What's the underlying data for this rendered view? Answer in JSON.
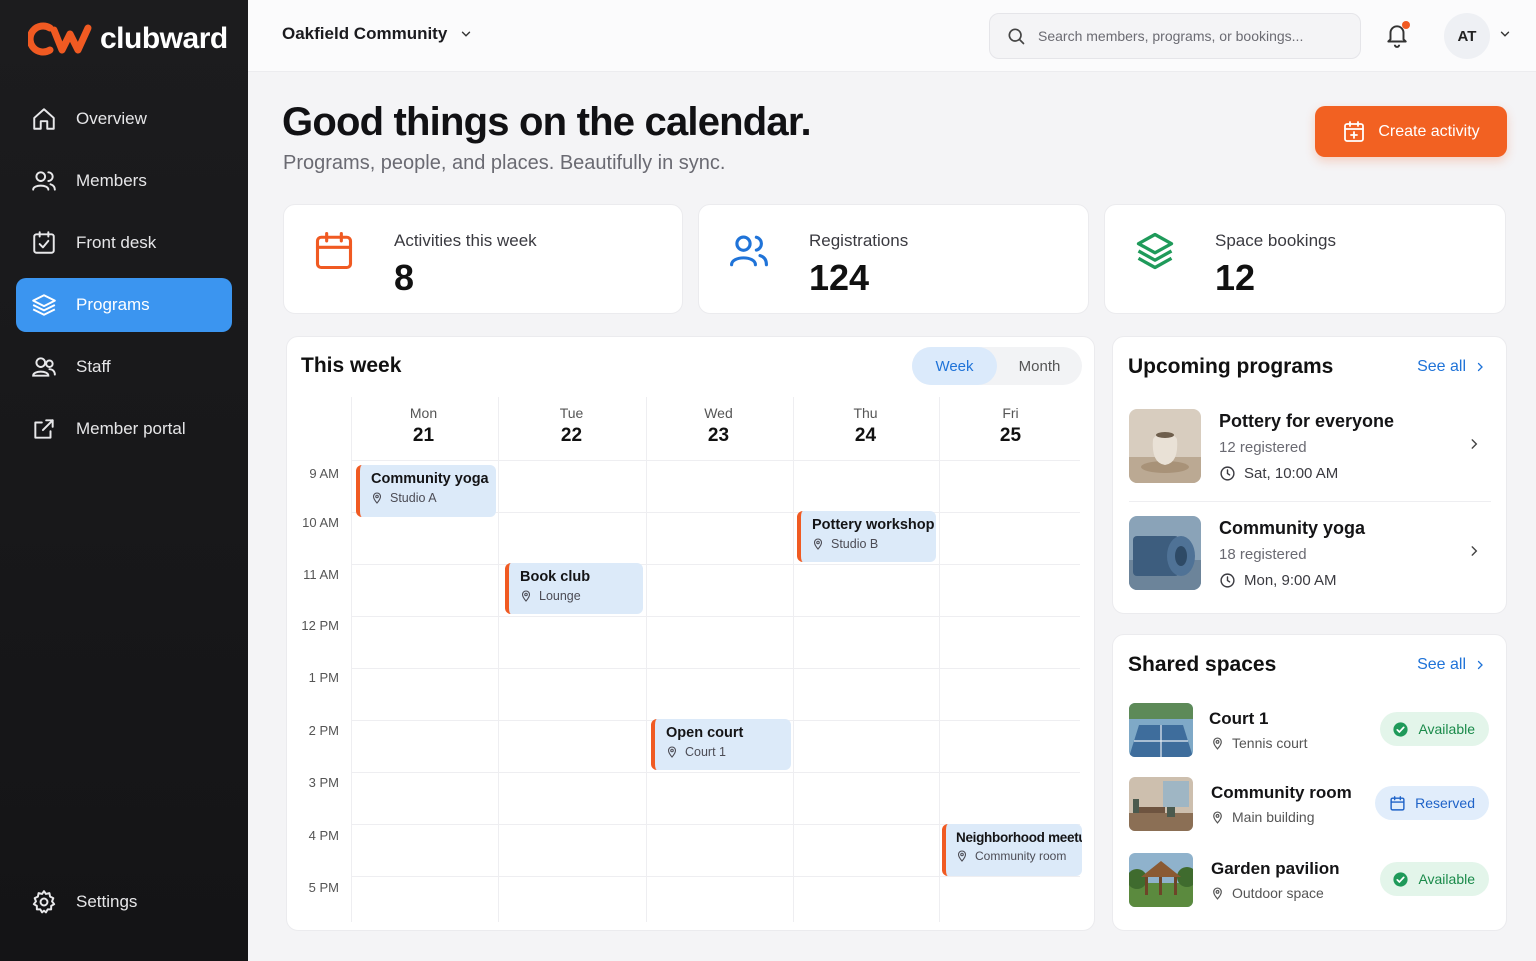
{
  "brand": {
    "name": "clubward",
    "accent": "#f26122",
    "nav_active": "#3b95f0"
  },
  "sidebar": {
    "items": [
      {
        "label": "Overview",
        "icon": "home-icon"
      },
      {
        "label": "Members",
        "icon": "users-icon"
      },
      {
        "label": "Front desk",
        "icon": "calendar-check-icon"
      },
      {
        "label": "Programs",
        "icon": "layers-icon",
        "active": true
      },
      {
        "label": "Staff",
        "icon": "user-group-icon"
      },
      {
        "label": "Member portal",
        "icon": "external-link-icon"
      }
    ],
    "settings_label": "Settings"
  },
  "topbar": {
    "org": "Oakfield Community",
    "search_placeholder": "Search members, programs, or bookings...",
    "avatar": "AT"
  },
  "header": {
    "title": "Good things on the calendar.",
    "subtitle": "Programs, people, and places. Beautifully in sync.",
    "create_label": "Create activity"
  },
  "stats": [
    {
      "label": "Activities this week",
      "value": "8",
      "icon": "calendar-icon"
    },
    {
      "label": "Registrations",
      "value": "124",
      "icon": "users-icon"
    },
    {
      "label": "Space bookings",
      "value": "12",
      "icon": "layers-icon"
    }
  ],
  "calendar": {
    "title": "This week",
    "views": [
      "Week",
      "Month"
    ],
    "active_view": "Week",
    "days": [
      {
        "name": "Mon",
        "date": "21"
      },
      {
        "name": "Tue",
        "date": "22"
      },
      {
        "name": "Wed",
        "date": "23"
      },
      {
        "name": "Thu",
        "date": "24"
      },
      {
        "name": "Fri",
        "date": "25"
      }
    ],
    "hours": [
      "9 AM",
      "10 AM",
      "11 AM",
      "12 PM",
      "1 PM",
      "2 PM",
      "3 PM",
      "4 PM",
      "5 PM"
    ],
    "events": [
      {
        "title": "Community yoga",
        "location": "Studio A",
        "day": 0,
        "hour": 0
      },
      {
        "title": "Pottery workshop",
        "location": "Studio B",
        "day": 3,
        "hour": 1
      },
      {
        "title": "Book club",
        "location": "Lounge",
        "day": 1,
        "hour": 2
      },
      {
        "title": "Open court",
        "location": "Court 1",
        "day": 2,
        "hour": 5
      },
      {
        "title": "Neighborhood meetup",
        "location": "Community room",
        "day": 4,
        "hour": 7
      }
    ]
  },
  "upcoming": {
    "title": "Upcoming programs",
    "see_all": "See all",
    "items": [
      {
        "title": "Pottery for everyone",
        "registered": "12 registered",
        "when": "Sat, 10:00 AM"
      },
      {
        "title": "Community yoga",
        "registered": "18 registered",
        "when": "Mon, 9:00 AM"
      }
    ]
  },
  "spaces": {
    "title": "Shared spaces",
    "see_all": "See all",
    "items": [
      {
        "name": "Court 1",
        "location": "Tennis court",
        "status": "Available"
      },
      {
        "name": "Community room",
        "location": "Main building",
        "status": "Reserved"
      },
      {
        "name": "Garden pavilion",
        "location": "Outdoor space",
        "status": "Available"
      }
    ]
  }
}
